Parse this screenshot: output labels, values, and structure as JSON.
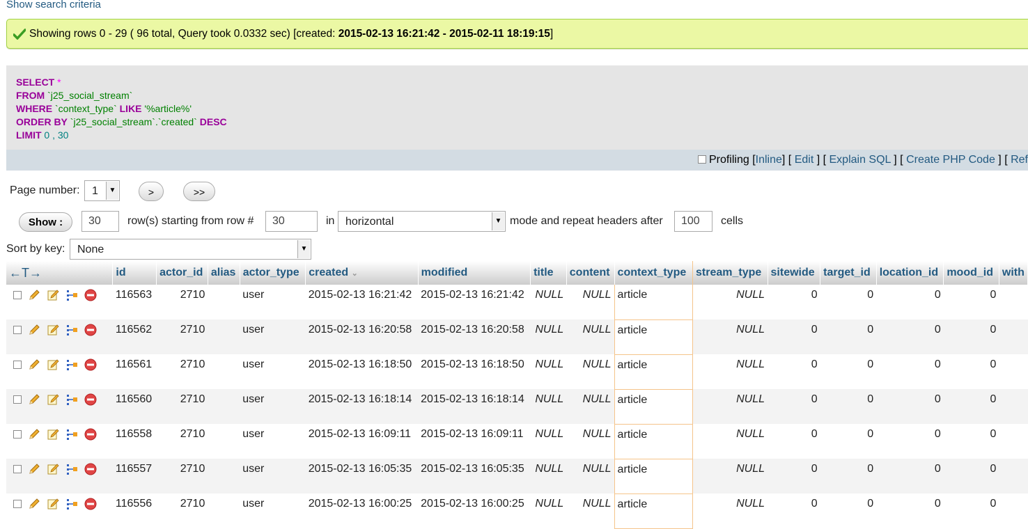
{
  "top_link": "Show search criteria",
  "message": {
    "prefix": "Showing rows 0 - 29 ( 96 total, Query took 0.0332 sec) [created: ",
    "range": "2015-02-13 16:21:42 - 2015-02-11 18:19:15",
    "suffix": "]"
  },
  "sql": {
    "l1_kw": "SELECT",
    "l1_rest": " *",
    "l2_kw": "FROM",
    "l2_rest": " `j25_social_stream`",
    "l3_kw": "WHERE",
    "l3_col": " `context_type` ",
    "l3_kw2": "LIKE",
    "l3_str": " '%article%'",
    "l4_kw": "ORDER BY",
    "l4_rest": " `j25_social_stream`.`created` ",
    "l4_kw2": "DESC",
    "l5_kw": "LIMIT",
    "l5_rest": " 0 , 30"
  },
  "sqlbar": {
    "profiling": "Profiling",
    "inline": "Inline",
    "edit": "Edit",
    "explain": "Explain SQL",
    "php": "Create PHP Code",
    "refresh": "Ref"
  },
  "nav": {
    "page_label": "Page number:",
    "page_value": "1",
    "next": ">",
    "last": ">>",
    "show": "Show :",
    "rows": "30",
    "rows_label": "row(s) starting from row #",
    "start": "30",
    "in": "in",
    "mode": "horizontal",
    "mode_label": "mode and repeat headers after",
    "repeat": "100",
    "cells": "cells",
    "sort_label": "Sort by key:",
    "sort_value": "None"
  },
  "table": {
    "options": "←T→",
    "headers": [
      "id",
      "actor_id",
      "alias",
      "actor_type",
      "created",
      "modified",
      "title",
      "content",
      "context_type",
      "stream_type",
      "sitewide",
      "target_id",
      "location_id",
      "mood_id",
      "with"
    ],
    "sort_arrow": "⌄",
    "rows": [
      [
        "116563",
        "2710",
        "",
        "user",
        "2015-02-13 16:21:42",
        "2015-02-13 16:21:42",
        "NULL",
        "NULL",
        "article",
        "NULL",
        "0",
        "0",
        "0",
        "0"
      ],
      [
        "116562",
        "2710",
        "",
        "user",
        "2015-02-13 16:20:58",
        "2015-02-13 16:20:58",
        "NULL",
        "NULL",
        "article",
        "NULL",
        "0",
        "0",
        "0",
        "0"
      ],
      [
        "116561",
        "2710",
        "",
        "user",
        "2015-02-13 16:18:50",
        "2015-02-13 16:18:50",
        "NULL",
        "NULL",
        "article",
        "NULL",
        "0",
        "0",
        "0",
        "0"
      ],
      [
        "116560",
        "2710",
        "",
        "user",
        "2015-02-13 16:18:14",
        "2015-02-13 16:18:14",
        "NULL",
        "NULL",
        "article",
        "NULL",
        "0",
        "0",
        "0",
        "0"
      ],
      [
        "116558",
        "2710",
        "",
        "user",
        "2015-02-13 16:09:11",
        "2015-02-13 16:09:11",
        "NULL",
        "NULL",
        "article",
        "NULL",
        "0",
        "0",
        "0",
        "0"
      ],
      [
        "116557",
        "2710",
        "",
        "user",
        "2015-02-13 16:05:35",
        "2015-02-13 16:05:35",
        "NULL",
        "NULL",
        "article",
        "NULL",
        "0",
        "0",
        "0",
        "0"
      ],
      [
        "116556",
        "2710",
        "",
        "user",
        "2015-02-13 16:00:25",
        "2015-02-13 16:00:25",
        "NULL",
        "NULL",
        "article",
        "NULL",
        "0",
        "0",
        "0",
        "0"
      ]
    ]
  },
  "colors": {
    "success_bg": "#ebf8a4",
    "link": "#235a81",
    "keyword": "#990099",
    "string": "#008000"
  }
}
